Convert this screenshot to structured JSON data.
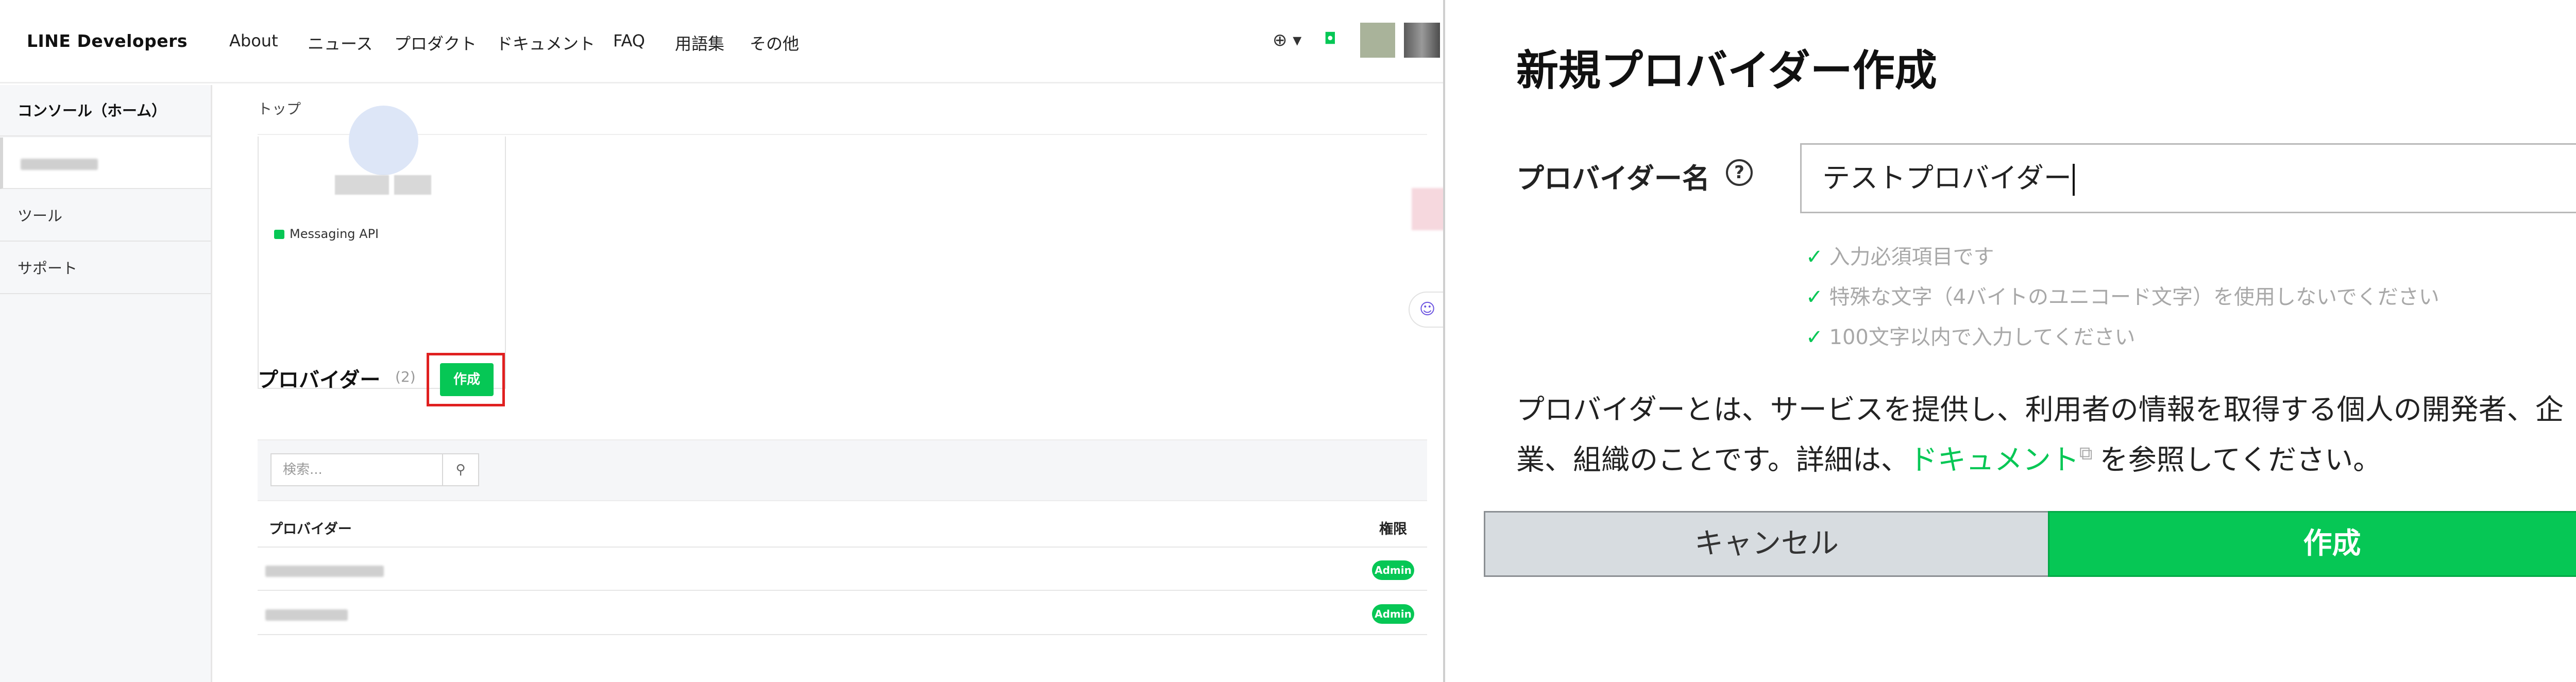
{
  "header": {
    "logo": "LINE Developers",
    "nav": [
      "About",
      "ニュース",
      "プロダクト",
      "ドキュメント",
      "FAQ",
      "用語集",
      "その他"
    ],
    "globe": "⊕ ▾",
    "bell": "◘"
  },
  "sidebar": {
    "items": [
      {
        "label": "コンソール（ホーム）"
      },
      {
        "label": ""
      },
      {
        "label": "ツール"
      },
      {
        "label": "サポート"
      }
    ]
  },
  "main": {
    "breadcrumb": "トップ",
    "channel_card": {
      "label": "Messaging API"
    },
    "providers": {
      "title": "プロバイダー",
      "count": "(2)",
      "create_label": "作成",
      "search_placeholder": "検索...",
      "search_icon": "⚲",
      "col_provider": "プロバイダー",
      "col_permission": "権限",
      "rows": [
        {
          "role": "Admin"
        },
        {
          "role": "Admin"
        }
      ]
    },
    "help_icon": "☺"
  },
  "dialog": {
    "title": "新規プロバイダー作成",
    "field_label": "プロバイダー名",
    "help_icon": "?",
    "input_value": "テストプロバイダー",
    "hints": [
      "入力必須項目です",
      "特殊な文字（4バイトのユニコード文字）を使用しないでください",
      "100文字以内で入力してください"
    ],
    "check_icon": "✓",
    "desc_before": "プロバイダーとは、サービスを提供し、利用者の情報を取得する個人の開発者、企業、組織のことです。詳細は、",
    "desc_link": "ドキュメント",
    "desc_ext": "⧉",
    "desc_after": "を参照してください。",
    "cancel_label": "キャンセル",
    "create_label": "作成"
  },
  "colors": {
    "accent": "#06c755",
    "highlight_frame": "#e02020"
  }
}
